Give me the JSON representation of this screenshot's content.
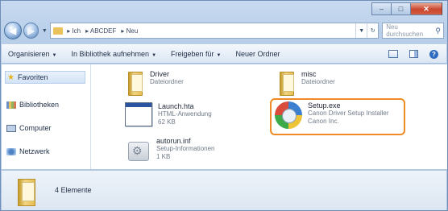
{
  "window": {
    "caption": {
      "minimize": "–",
      "maximize": "□",
      "close": "✕"
    }
  },
  "nav": {
    "back": "◀",
    "forward": "▶",
    "address_segments": [
      "▸ Ich",
      "▸ ABCDEF",
      "▸ Neu"
    ],
    "search_placeholder": "Neu durchsuchen"
  },
  "toolbar": {
    "organize": "Organisieren",
    "include_library": "In Bibliothek aufnehmen",
    "share": "Freigeben für",
    "new_folder": "Neuer Ordner"
  },
  "sidebar": {
    "items": [
      {
        "label": "Favoriten"
      },
      {
        "label": "Bibliotheken"
      },
      {
        "label": "Computer"
      },
      {
        "label": "Netzwerk"
      }
    ]
  },
  "files": [
    {
      "name": "Driver",
      "sub": "Dateiordner"
    },
    {
      "name": "misc",
      "sub": "Dateiordner"
    },
    {
      "name": "Launch.hta",
      "sub": "HTML-Anwendung",
      "sub2": "62 KB"
    },
    {
      "name": "Setup.exe",
      "sub": "Canon Driver Setup Installer",
      "sub2": "Canon Inc."
    },
    {
      "name": "autorun.inf",
      "sub": "Setup-Informationen",
      "sub2": "1 KB"
    }
  ],
  "details": {
    "label": "4 Elemente"
  },
  "colors": {
    "highlight": "#f08a24"
  }
}
